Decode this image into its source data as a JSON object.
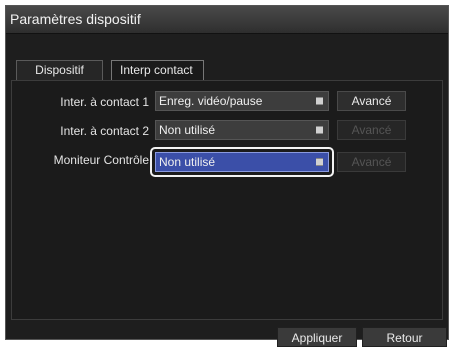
{
  "window": {
    "title": "Paramètres dispositif"
  },
  "tabs": [
    {
      "label": "Dispositif",
      "active": false
    },
    {
      "label": "Interp contact",
      "active": true
    }
  ],
  "rows": [
    {
      "label": "Inter. à contact 1",
      "value": "Enreg. vidéo/pause",
      "advanced": "Avancé",
      "advanced_enabled": true,
      "focused": false
    },
    {
      "label": "Inter. à contact 2",
      "value": "Non utilisé",
      "advanced": "Avancé",
      "advanced_enabled": false,
      "focused": false
    },
    {
      "label": "Moniteur Contrôle",
      "value": "Non utilisé",
      "advanced": "Avancé",
      "advanced_enabled": false,
      "focused": true
    }
  ],
  "footer": {
    "apply_label": "Appliquer",
    "back_label": "Retour"
  },
  "colors": {
    "focused_select": "#3b4fa8",
    "background": "#1e1e1e"
  }
}
